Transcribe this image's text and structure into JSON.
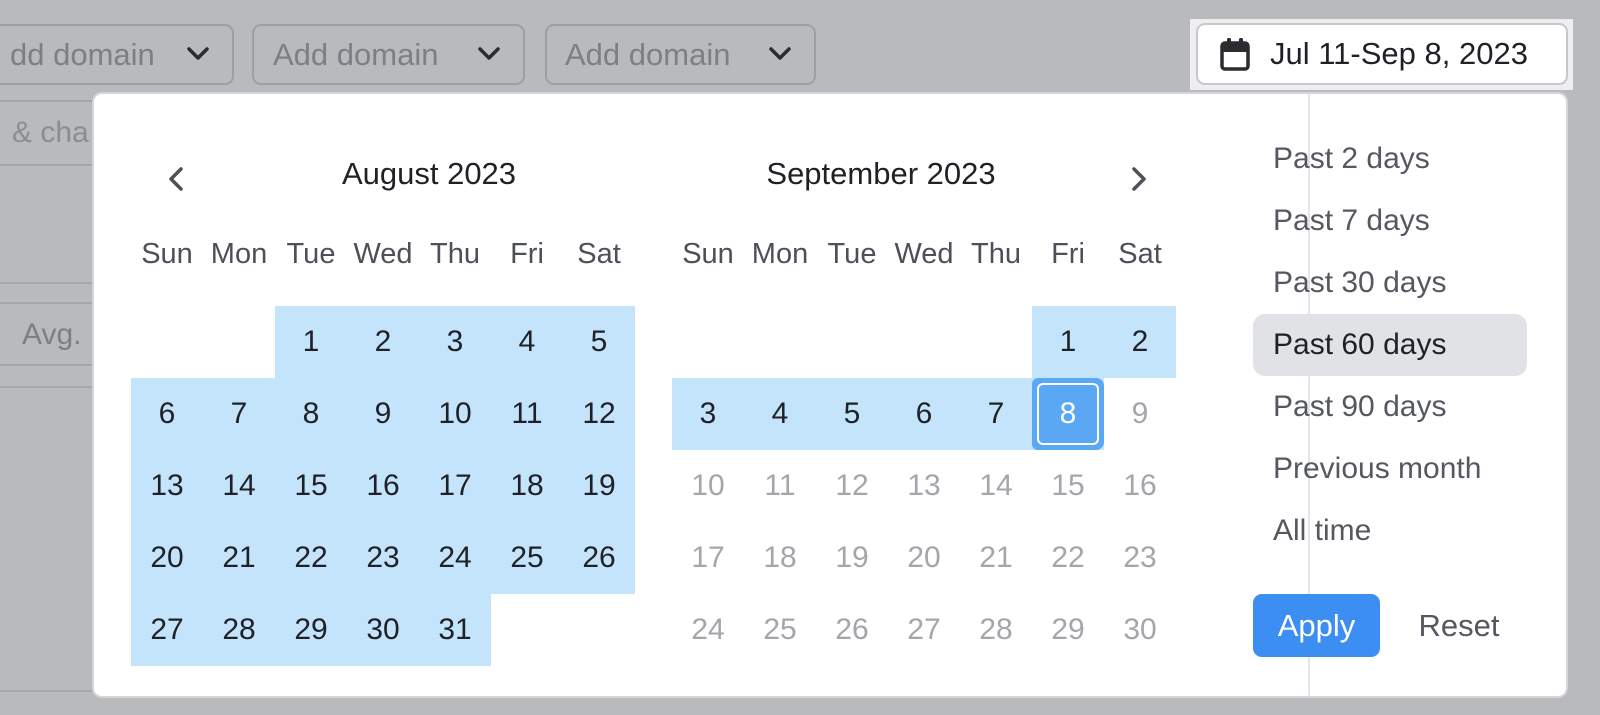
{
  "filters": {
    "domain_placeholders": [
      "dd domain",
      "Add domain",
      "Add domain"
    ],
    "search_fragment": "& cha",
    "metric_fragment": "Avg."
  },
  "date_trigger": {
    "label": "Jul 11-Sep 8, 2023",
    "icon": "calendar-icon"
  },
  "calendar": {
    "left_month": {
      "title": "August 2023",
      "weekdays": [
        "Sun",
        "Mon",
        "Tue",
        "Wed",
        "Thu",
        "Fri",
        "Sat"
      ],
      "leading_blanks": 2,
      "days": [
        "1",
        "2",
        "3",
        "4",
        "5",
        "6",
        "7",
        "8",
        "9",
        "10",
        "11",
        "12",
        "13",
        "14",
        "15",
        "16",
        "17",
        "18",
        "19",
        "20",
        "21",
        "22",
        "23",
        "24",
        "25",
        "26",
        "27",
        "28",
        "29",
        "30",
        "31"
      ],
      "range_first": 1,
      "range_last": 31
    },
    "right_month": {
      "title": "September 2023",
      "weekdays": [
        "Sun",
        "Mon",
        "Tue",
        "Wed",
        "Thu",
        "Fri",
        "Sat"
      ],
      "leading_blanks": 5,
      "days": [
        "1",
        "2",
        "3",
        "4",
        "5",
        "6",
        "7",
        "8",
        "9",
        "10",
        "11",
        "12",
        "13",
        "14",
        "15",
        "16",
        "17",
        "18",
        "19",
        "20",
        "21",
        "22",
        "23",
        "24",
        "25",
        "26",
        "27",
        "28",
        "29",
        "30"
      ],
      "range_first": 1,
      "range_last": 8,
      "selected_day": 8
    },
    "prev_icon": "chevron-left-icon",
    "next_icon": "chevron-right-icon"
  },
  "presets": {
    "items": [
      "Past 2 days",
      "Past 7 days",
      "Past 30 days",
      "Past 60 days",
      "Past 90 days",
      "Previous month",
      "All time"
    ],
    "active": "Past 60 days"
  },
  "actions": {
    "apply": "Apply",
    "reset": "Reset"
  },
  "colors": {
    "range": "#c4e4fc",
    "selected": "#5aa8f4",
    "apply": "#3d8ef2",
    "active_preset": "#e1e2e5"
  }
}
